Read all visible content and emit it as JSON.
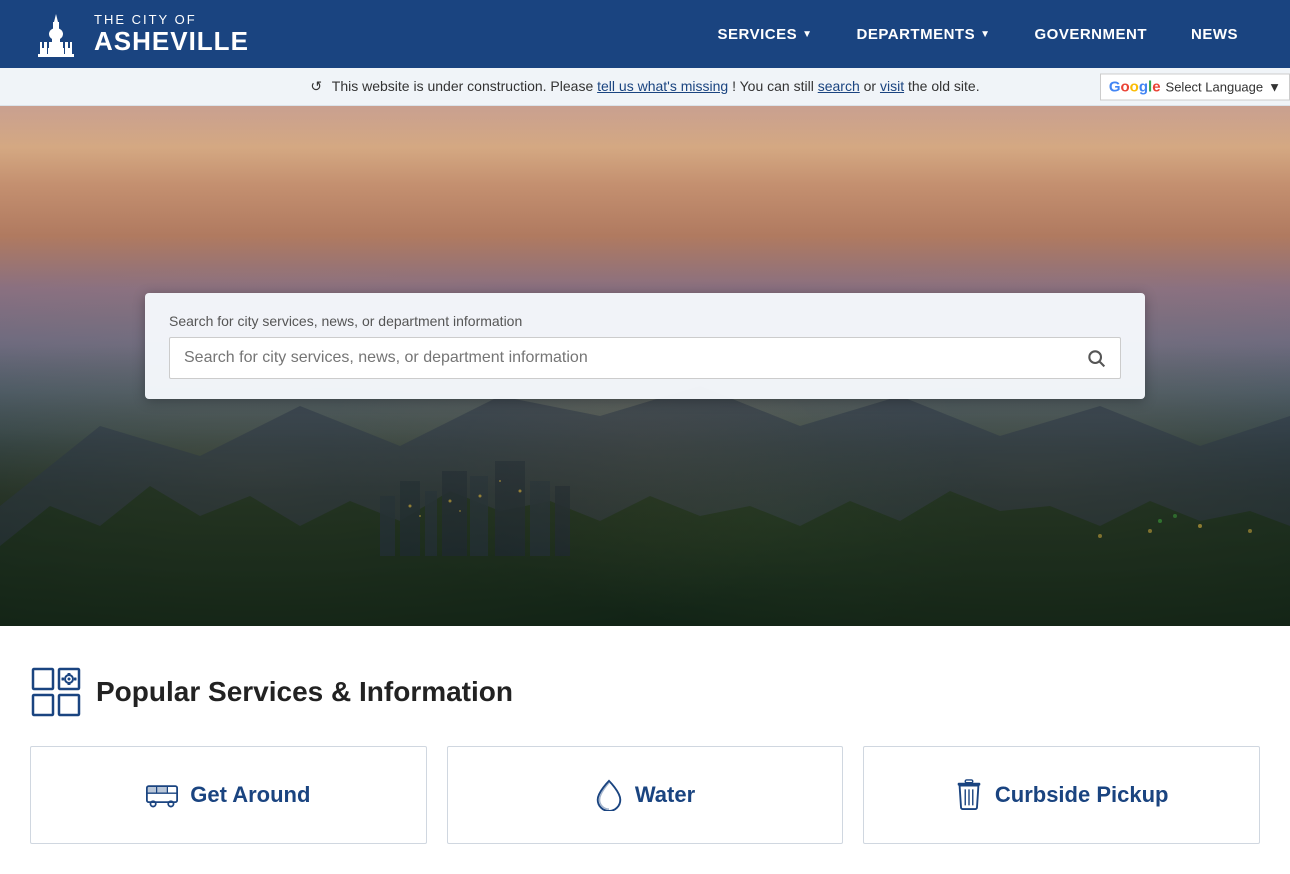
{
  "header": {
    "logo": {
      "the_city_of": "THE CITY OF",
      "asheville": "ASHEVILLE"
    },
    "nav": [
      {
        "label": "SERVICES",
        "has_dropdown": true
      },
      {
        "label": "DEPARTMENTS",
        "has_dropdown": true
      },
      {
        "label": "GOVERNMENT",
        "has_dropdown": false
      },
      {
        "label": "NEWS",
        "has_dropdown": false
      }
    ]
  },
  "notice": {
    "text_before": "This website is under construction. Please ",
    "link1_text": "tell us what's missing",
    "text_middle": "! You can still ",
    "link2_text": "search",
    "text_or": " or ",
    "link3_text": "visit",
    "text_after": " the old site."
  },
  "language_selector": {
    "label": "Select Language",
    "dropdown_arrow": "▼"
  },
  "search": {
    "placeholder": "Search for city services, news, or department information",
    "button_label": "Search"
  },
  "services_section": {
    "title": "Popular Services & Information",
    "cards": [
      {
        "label": "Get Around",
        "icon": "bus"
      },
      {
        "label": "Water",
        "icon": "water-drop"
      },
      {
        "label": "Curbside Pickup",
        "icon": "trash"
      }
    ]
  }
}
